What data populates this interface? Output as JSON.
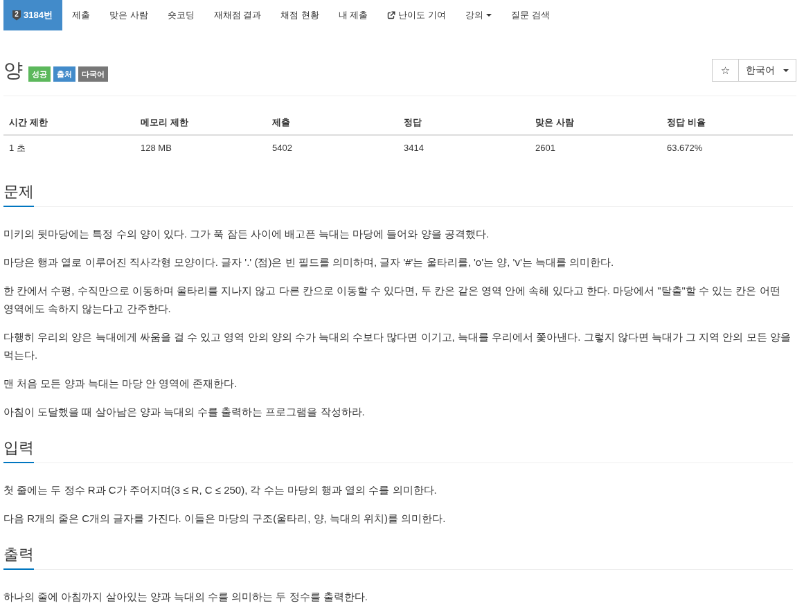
{
  "nav": [
    {
      "label": "3184번",
      "kind": "problem",
      "badge": "2",
      "selected": true
    },
    {
      "label": "제출",
      "kind": "link",
      "selected": false
    },
    {
      "label": "맞은 사람",
      "kind": "link",
      "selected": false
    },
    {
      "label": "숏코딩",
      "kind": "link",
      "selected": false
    },
    {
      "label": "재채점 결과",
      "kind": "link",
      "selected": false
    },
    {
      "label": "채점 현황",
      "kind": "link",
      "selected": false
    },
    {
      "label": "내 제출",
      "kind": "link",
      "selected": false
    },
    {
      "label": "난이도 기여",
      "kind": "external",
      "selected": false
    },
    {
      "label": "강의",
      "kind": "menu",
      "selected": false
    },
    {
      "label": "질문 검색",
      "kind": "link",
      "selected": false
    }
  ],
  "problem": {
    "title": "양",
    "badges": [
      {
        "label": "성공",
        "color": "#5cb85c"
      },
      {
        "label": "출처",
        "color": "#428bca"
      },
      {
        "label": "다국어",
        "color": "#777777"
      }
    ],
    "star_button": "☆",
    "language": "한국어"
  },
  "info_table": {
    "columns": [
      "시간 제한",
      "메모리 제한",
      "제출",
      "정답",
      "맞은 사람",
      "정답 비율"
    ],
    "rows": [
      [
        "1 초",
        "128 MB",
        "5402",
        "3414",
        "2601",
        "63.672%"
      ]
    ]
  },
  "sections": [
    {
      "title": "문제",
      "paragraphs": [
        "미키의 뒷마당에는 특정 수의 양이 있다. 그가 푹 잠든 사이에 배고픈 늑대는 마당에 들어와 양을 공격했다.",
        "마당은 행과 열로 이루어진 직사각형 모양이다. 글자 '.' (점)은 빈 필드를 의미하며, 글자 '#'는 울타리를, 'o'는 양, 'v'는 늑대를 의미한다.",
        "한 칸에서 수평, 수직만으로 이동하며 울타리를 지나지 않고 다른 칸으로 이동할 수 있다면, 두 칸은 같은 영역 안에 속해 있다고 한다. 마당에서 \"탈출\"할 수 있는 칸은 어떤 영역에도 속하지 않는다고 간주한다.",
        "다행히 우리의 양은 늑대에게 싸움을 걸 수 있고 영역 안의 양의 수가 늑대의 수보다 많다면 이기고, 늑대를 우리에서 쫓아낸다. 그렇지 않다면 늑대가 그 지역 안의 모든 양을 먹는다.",
        "맨 처음 모든 양과 늑대는 마당 안 영역에 존재한다.",
        "아침이 도달했을 때 살아남은 양과 늑대의 수를 출력하는 프로그램을 작성하라."
      ]
    },
    {
      "title": "입력",
      "paragraphs": [
        "첫 줄에는 두 정수 R과 C가 주어지며(3 ≤ R, C ≤ 250), 각 수는 마당의 행과 열의 수를 의미한다.",
        "다음 R개의 줄은 C개의 글자를 가진다. 이들은 마당의 구조(울타리, 양, 늑대의 위치)를 의미한다."
      ]
    },
    {
      "title": "출력",
      "paragraphs": [
        "하나의 줄에 아침까지 살아있는 양과 늑대의 수를 의미하는 두 정수를 출력한다."
      ]
    }
  ]
}
